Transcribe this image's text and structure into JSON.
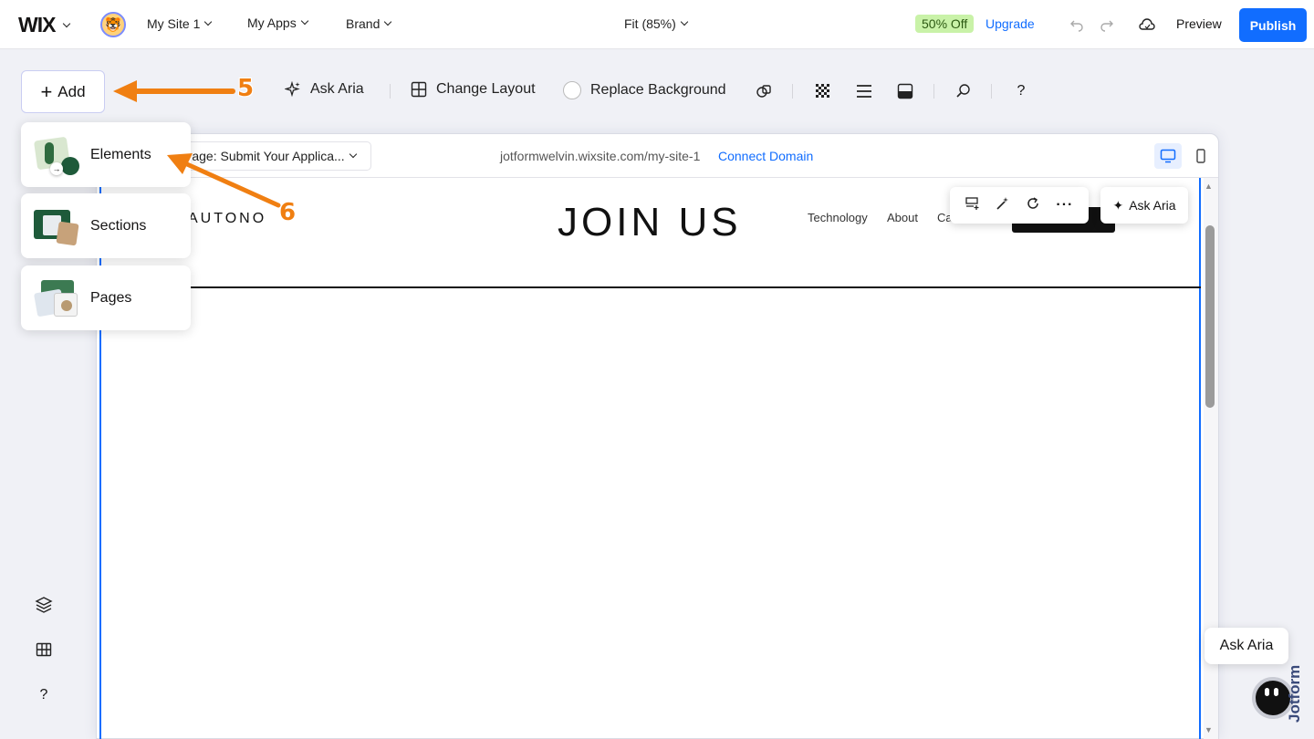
{
  "topbar": {
    "logo": "WIX",
    "site_name": "My Site 1",
    "apps": "My Apps",
    "brand": "Brand",
    "zoom": "Fit (85%)",
    "discount": "50% Off",
    "upgrade": "Upgrade",
    "preview": "Preview",
    "publish": "Publish"
  },
  "toolbar": {
    "add": "Add",
    "ask_aria": "Ask Aria",
    "change_layout": "Change Layout",
    "replace_background": "Replace Background",
    "help": "?"
  },
  "canvas": {
    "page_select": "Page: Submit Your Applica...",
    "url": "jotformwelvin.wixsite.com/my-site-1",
    "connect_domain": "Connect Domain",
    "brand_logo": "AUTONO",
    "title": "JOIN US",
    "nav": [
      "Technology",
      "About",
      "Ca"
    ],
    "float_ask_aria": "Ask Aria"
  },
  "add_menu": {
    "items": [
      "Elements",
      "Sections",
      "Pages"
    ]
  },
  "rail": {
    "help": "?"
  },
  "annotations": {
    "step5": "5",
    "step6": "6",
    "arrow_color": "#f07f12"
  },
  "aria_widget": {
    "label": "Ask Aria",
    "brand": "Jotform"
  },
  "colors": {
    "accent": "#116dff",
    "discount_bg": "#c9f2a8"
  }
}
